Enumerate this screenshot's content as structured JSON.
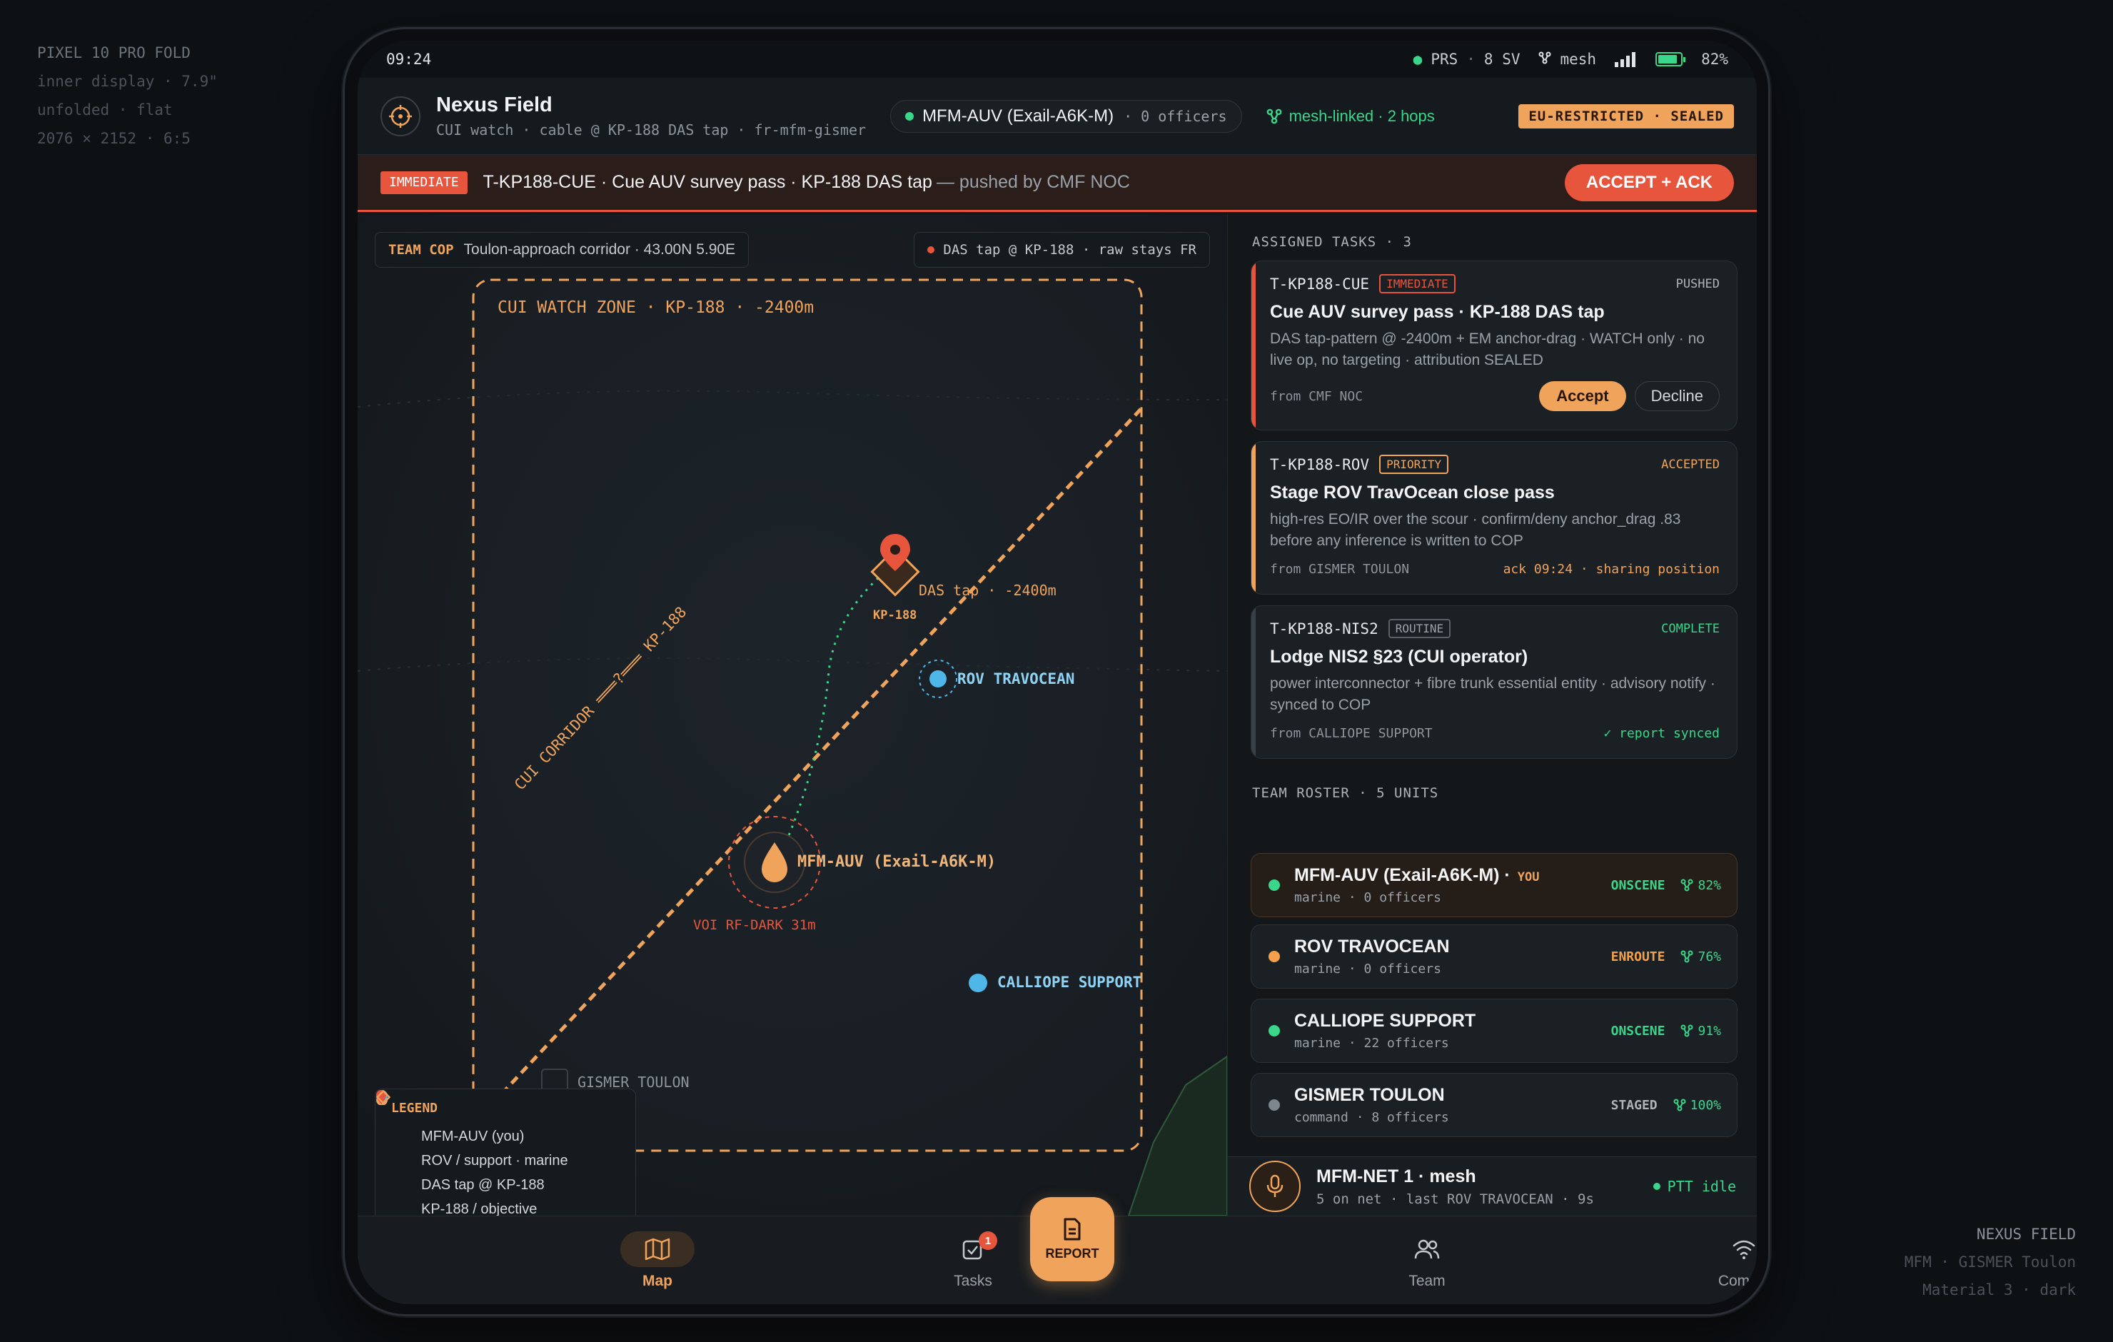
{
  "side_info": {
    "top_left": [
      "PIXEL 10 PRO FOLD",
      "inner display · 7.9\"",
      "unfolded · flat",
      "2076 × 2152 · 6:5"
    ],
    "bottom_right": [
      "NEXUS FIELD",
      "MFM · GISMER Toulon",
      "Material 3 · dark"
    ]
  },
  "statusbar": {
    "time": "09:24",
    "gnss": "PRS",
    "sats": "8 SV",
    "mesh": "mesh",
    "battery": "82%"
  },
  "header": {
    "title": "Nexus Field",
    "subtitle": "CUI watch · cable @ KP-188 DAS tap · fr-mfm-gismer",
    "unit_name": "MFM-AUV (Exail-A6K-M)",
    "unit_officers": "· 0 officers",
    "mesh_status": "mesh-linked · 2 hops",
    "classification": "EU-RESTRICTED · SEALED"
  },
  "banner": {
    "tag": "IMMEDIATE",
    "text": "T-KP188-CUE · Cue AUV survey pass · KP-188 DAS tap",
    "by": "— pushed by CMF NOC",
    "action": "ACCEPT + ACK"
  },
  "map": {
    "team_cop_label": "TEAM COP",
    "team_cop_text": "Toulon-approach corridor · 43.00N 5.90E",
    "das_chip": "DAS tap @ KP-188 · raw stays FR",
    "zone_label": "CUI WATCH ZONE · KP-188 · -2400m",
    "corridor_label": "CUI CORRIDOR ═══?═══ KP-188",
    "das_label": "DAS tap · -2400m",
    "kp_label": "KP-188",
    "rov_label": "ROV TRAVOCEAN",
    "self_label": "MFM-AUV (Exail-A6K-M)",
    "voi_label": "VOI RF-DARK 31m",
    "calliope_label": "CALLIOPE SUPPORT",
    "gismer_label": "GISMER TOULON",
    "legend": {
      "title": "LEGEND",
      "items": [
        "MFM-AUV (you)",
        "ROV / support · marine",
        "DAS tap @ KP-188",
        "KP-188 / objective"
      ]
    }
  },
  "tasks": {
    "title": "ASSIGNED TASKS · 3",
    "items": [
      {
        "id": "T-KP188-CUE",
        "priority": "IMMEDIATE",
        "status": "PUSHED",
        "title": "Cue AUV survey pass · KP-188 DAS tap",
        "desc": "DAS tap-pattern @ -2400m + EM anchor-drag · WATCH only · no live op, no targeting · attribution SEALED",
        "from": "from CMF NOC",
        "accept": "Accept",
        "decline": "Decline"
      },
      {
        "id": "T-KP188-ROV",
        "priority": "PRIORITY",
        "status": "ACCEPTED",
        "title": "Stage ROV TravOcean close pass",
        "desc": "high-res EO/IR over the scour · confirm/deny anchor_drag .83 before any inference is written to COP",
        "from": "from GISMER TOULON",
        "note": "ack 09:24 · sharing position"
      },
      {
        "id": "T-KP188-NIS2",
        "priority": "ROUTINE",
        "status": "COMPLETE",
        "title": "Lodge NIS2 §23 (CUI operator)",
        "desc": "power interconnector + fibre trunk essential entity · advisory notify · synced to COP",
        "from": "from CALLIOPE SUPPORT",
        "note": "✓ report synced"
      }
    ]
  },
  "roster": {
    "title": "TEAM ROSTER · 5 UNITS",
    "you_tag": "YOU",
    "units": [
      {
        "name": "MFM-AUV (Exail-A6K-M) ·",
        "sub": "marine · 0 officers",
        "status": "ONSCENE",
        "link": "82%"
      },
      {
        "name": "ROV TRAVOCEAN",
        "sub": "marine · 0 officers",
        "status": "ENROUTE",
        "link": "76%"
      },
      {
        "name": "CALLIOPE SUPPORT",
        "sub": "marine · 22 officers",
        "status": "ONSCENE",
        "link": "91%"
      },
      {
        "name": "GISMER TOULON",
        "sub": "command · 8 officers",
        "status": "STAGED",
        "link": "100%"
      }
    ]
  },
  "ptt": {
    "title": "MFM-NET 1 · mesh",
    "sub": "5 on net · last ROV TRAVOCEAN · 9s",
    "state": "PTT idle"
  },
  "nav": {
    "map": "Map",
    "tasks": "Tasks",
    "tasks_badge": "1",
    "report": "REPORT",
    "team": "Team",
    "comms": "Comms"
  },
  "colors": {
    "accent": "#f0a35a",
    "alert": "#e8553d",
    "ok": "#3ad68a",
    "blue": "#4fb6e8"
  }
}
